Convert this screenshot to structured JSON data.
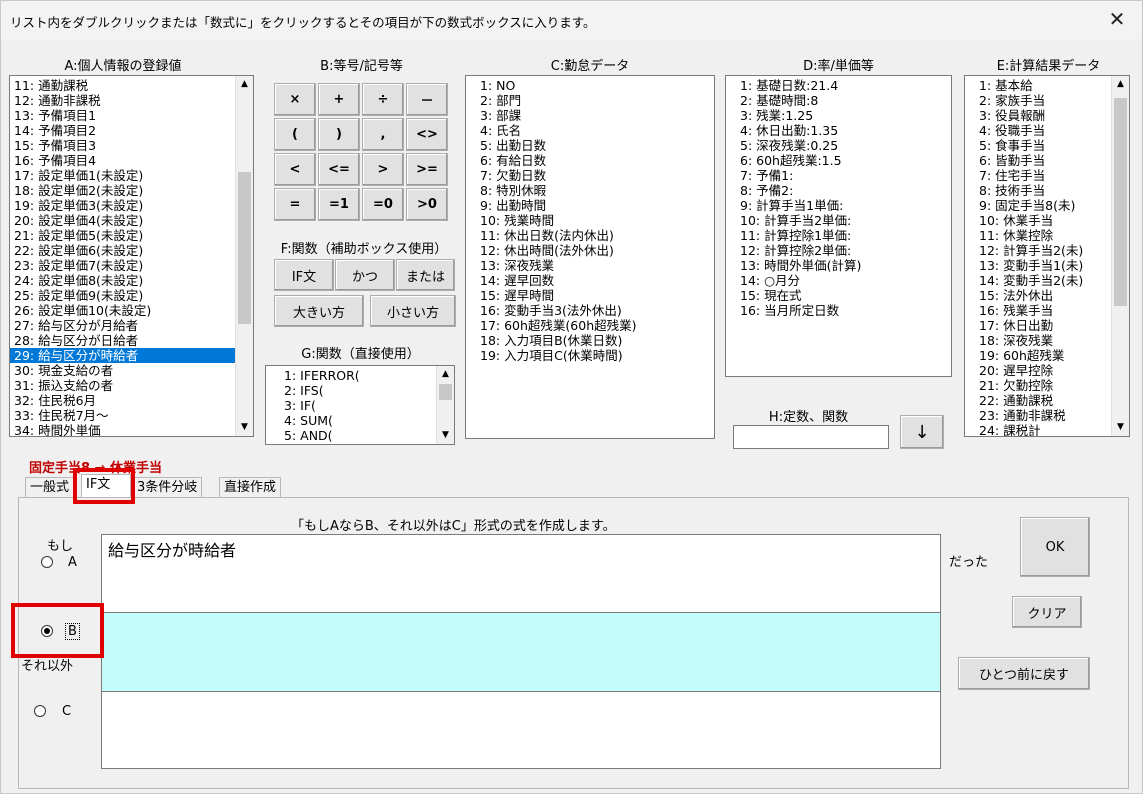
{
  "window": {
    "title": "リスト内をダブルクリックまたは「数式に」をクリックするとその項目が下の数式ボックスに入ります。",
    "close_glyph": "✕"
  },
  "headers": {
    "a": "A:個人情報の登録値",
    "b": "B:等号/記号等",
    "c": "C:勤怠データ",
    "d": "D:率/単価等",
    "e": "E:計算結果データ",
    "f": "F:関数（補助ボックス使用）",
    "g": "G:関数（直接使用）",
    "h": "H:定数、関数"
  },
  "listA": [
    "11: 通勤課税",
    "12: 通勤非課税",
    "13: 予備項目1",
    "14: 予備項目2",
    "15: 予備項目3",
    "16: 予備項目4",
    "17: 設定単価1(未設定)",
    "18: 設定単価2(未設定)",
    "19: 設定単価3(未設定)",
    "20: 設定単価4(未設定)",
    "21: 設定単価5(未設定)",
    "22: 設定単価6(未設定)",
    "23: 設定単価7(未設定)",
    "24: 設定単価8(未設定)",
    "25: 設定単価9(未設定)",
    "26: 設定単価10(未設定)",
    "27: 給与区分が月給者",
    "28: 給与区分が日給者",
    "29: 給与区分が時給者",
    "30: 現金支給の者",
    "31: 振込支給の者",
    "32: 住民税6月",
    "33: 住民税7月～",
    "34: 時間外単価"
  ],
  "listA_selected": "29: 給与区分が時給者",
  "symbols": [
    [
      "×",
      "+",
      "÷",
      "－"
    ],
    [
      "(",
      ")",
      ",",
      "<>"
    ],
    [
      "<",
      "<=",
      ">",
      ">="
    ],
    [
      "=",
      "=1",
      "=0",
      ">0"
    ]
  ],
  "fbuttons": {
    "if": "IF文",
    "and": "かつ",
    "or": "または",
    "max": "大きい方",
    "min": "小さい方"
  },
  "listG": [
    "1: IFERROR(",
    "2: IFS(",
    "3: IF(",
    "4: SUM(",
    "5: AND("
  ],
  "listC": [
    "1: NO",
    "2: 部門",
    "3: 部課",
    "4: 氏名",
    "5: 出勤日数",
    "6: 有給日数",
    "7: 欠勤日数",
    "8: 特別休暇",
    "9: 出勤時間",
    "10: 残業時間",
    "11: 休出日数(法内休出)",
    "12: 休出時間(法外休出)",
    "13: 深夜残業",
    "14: 遅早回数",
    "15: 遅早時間",
    "16: 変動手当3(法外休出)",
    "17: 60h超残業(60h超残業)",
    "18: 入力項目B(休業日数)",
    "19: 入力項目C(休業時間)"
  ],
  "listD": [
    "1: 基礎日数:21.4",
    "2: 基礎時間:8",
    "3: 残業:1.25",
    "4: 休日出勤:1.35",
    "5: 深夜残業:0.25",
    "6: 60h超残業:1.5",
    "7: 予備1:",
    "8: 予備2:",
    "9: 計算手当1単価:",
    "10: 計算手当2単価:",
    "11: 計算控除1単価:",
    "12: 計算控除2単価:",
    "13: 時間外単価(計算)",
    "14: ○月分",
    "15: 現在式",
    "16: 当月所定日数"
  ],
  "listE": [
    "1: 基本給",
    "2: 家族手当",
    "3: 役員報酬",
    "4: 役職手当",
    "5: 食事手当",
    "6: 皆勤手当",
    "7: 住宅手当",
    "8: 技術手当",
    "9: 固定手当8(未)",
    "10: 休業手当",
    "11: 休業控除",
    "12: 計算手当2(未)",
    "13: 変動手当1(未)",
    "14: 変動手当2(未)",
    "15: 法外休出",
    "16: 残業手当",
    "17: 休日出勤",
    "18: 深夜残業",
    "19: 60h超残業",
    "20: 遅早控除",
    "21: 欠勤控除",
    "22: 通勤課税",
    "23: 通勤非課税",
    "24: 課税計"
  ],
  "h": {
    "input_value": "",
    "arrow": "↓"
  },
  "target_label": "固定手当8 → 休業手当",
  "tabs": [
    "一般式",
    "IF文",
    "3条件分岐",
    "直接作成"
  ],
  "panel": {
    "desc": "「もしAならB、それ以外はC」形式の式を作成します。",
    "moshi": "もし",
    "a": "A",
    "b": "B",
    "c": "C",
    "sorei": "それ以外",
    "datta": "だった",
    "a_value": "給与区分が時給者",
    "b_value": "",
    "c_value": "",
    "ok": "OK",
    "clear": "クリア",
    "back": "ひとつ前に戻す"
  },
  "colors": {
    "selection": "#0078d7",
    "highlight": "#e00000",
    "b_box": "#c4fcfc"
  }
}
